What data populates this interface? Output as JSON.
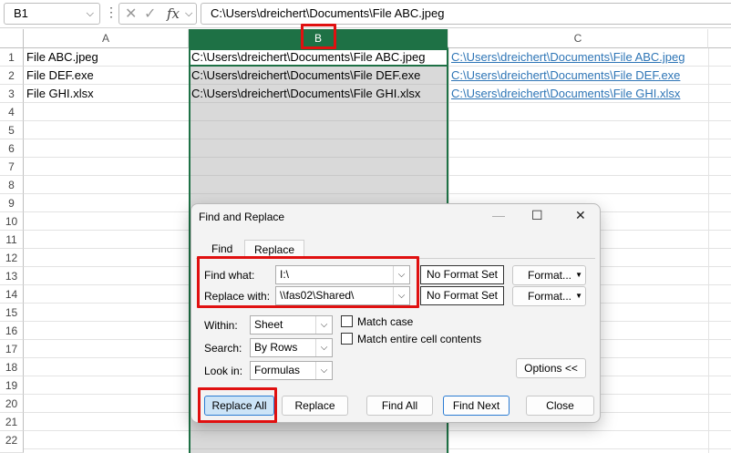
{
  "formula_bar": {
    "name_box": "B1",
    "formula": "C:\\Users\\dreichert\\Documents\\File ABC.jpeg"
  },
  "columns": [
    "A",
    "B",
    "C"
  ],
  "rows": [
    "1",
    "2",
    "3",
    "4",
    "5",
    "6",
    "7",
    "8",
    "9",
    "10",
    "11",
    "12",
    "13",
    "14",
    "15",
    "16",
    "17",
    "18",
    "19",
    "20",
    "21",
    "22"
  ],
  "cells": {
    "A1": "File ABC.jpeg",
    "A2": "File DEF.exe",
    "A3": "File GHI.xlsx",
    "B1": "C:\\Users\\dreichert\\Documents\\File ABC.jpeg",
    "B2": "C:\\Users\\dreichert\\Documents\\File DEF.exe",
    "B3": "C:\\Users\\dreichert\\Documents\\File GHI.xlsx",
    "C1": "C:\\Users\\dreichert\\Documents\\File ABC.jpeg",
    "C2": "C:\\Users\\dreichert\\Documents\\File DEF.exe",
    "C3": "C:\\Users\\dreichert\\Documents\\File GHI.xlsx"
  },
  "dialog": {
    "title": "Find and Replace",
    "tabs": {
      "find": "Find",
      "replace": "Replace"
    },
    "find_what_label": "Find what:",
    "find_what_value": "I:\\",
    "replace_with_label": "Replace with:",
    "replace_with_value": "\\\\fas02\\Shared\\",
    "no_format_1": "No Format Set",
    "no_format_2": "No Format Set",
    "format_1": "Format...",
    "format_2": "Format...",
    "within_label": "Within:",
    "within_value": "Sheet",
    "search_label": "Search:",
    "search_value": "By Rows",
    "lookin_label": "Look in:",
    "lookin_value": "Formulas",
    "match_case": "Match case",
    "match_entire": "Match entire cell contents",
    "options": "Options <<",
    "replace_all": "Replace All",
    "replace": "Replace",
    "find_all": "Find All",
    "find_next": "Find Next",
    "close": "Close"
  },
  "colors": {
    "selection_green": "#1e7145",
    "highlight_red": "#e01010",
    "link_blue": "#2e75b6"
  }
}
